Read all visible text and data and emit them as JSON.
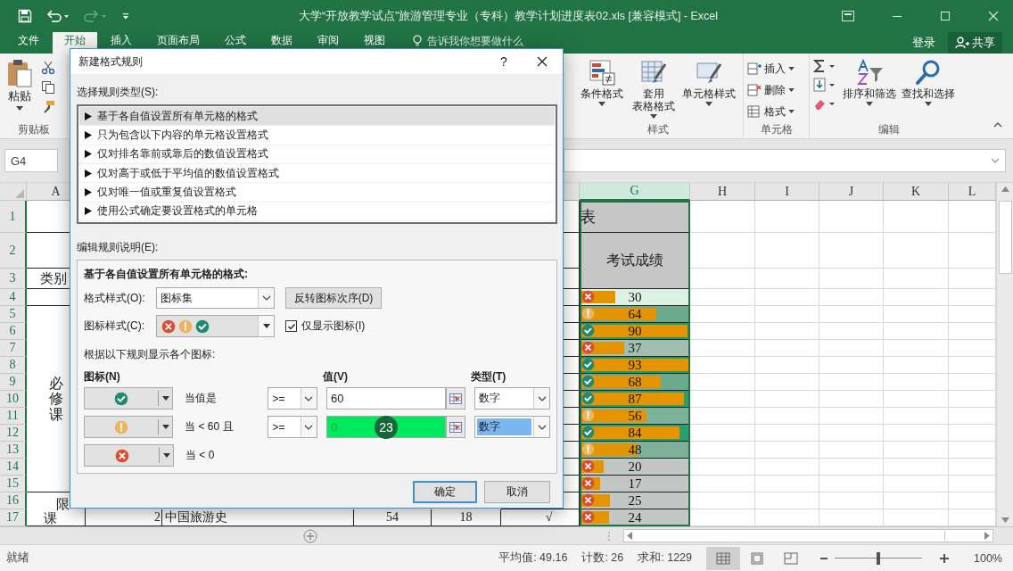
{
  "title_bar": {
    "title": "大学“开放教学试点”旅游管理专业（专科）教学计划进度表02.xls  [兼容模式] - Excel"
  },
  "ribbon_tabs": [
    {
      "label": "文件",
      "selected": false
    },
    {
      "label": "开始",
      "selected": true
    },
    {
      "label": "插入",
      "selected": false
    },
    {
      "label": "页面布局",
      "selected": false
    },
    {
      "label": "公式",
      "selected": false
    },
    {
      "label": "数据",
      "selected": false
    },
    {
      "label": "审阅",
      "selected": false
    },
    {
      "label": "视图",
      "selected": false
    }
  ],
  "tell_me": {
    "placeholder": "告诉我你想要做什么"
  },
  "account": {
    "sign_in": "登录",
    "share": "共享"
  },
  "ribbon": {
    "clipboard": {
      "paste": "粘贴",
      "label": "剪贴板"
    },
    "styles": {
      "items": [
        [
          "条件格式"
        ],
        [
          "套用",
          "表格格式"
        ],
        [
          "单元格样式"
        ]
      ],
      "label": "样式"
    },
    "cells": {
      "items": [
        "插入",
        "删除",
        "格式"
      ],
      "label": "单元格"
    },
    "editing": {
      "items": [
        "排序和筛选",
        "查找和选择"
      ],
      "label": "编辑"
    }
  },
  "name_box": "G4",
  "sheet": {
    "columns": [
      {
        "label": "A",
        "selected": false
      },
      {
        "label": "G",
        "selected": true
      },
      {
        "label": "H",
        "selected": false
      },
      {
        "label": "I",
        "selected": false
      },
      {
        "label": "J",
        "selected": false
      },
      {
        "label": "K",
        "selected": false
      },
      {
        "label": "L",
        "selected": false
      }
    ],
    "row_numbers": [
      "1",
      "2",
      "3",
      "4",
      "5",
      "6",
      "7",
      "8",
      "9",
      "10",
      "11",
      "12",
      "13",
      "14",
      "15",
      "16",
      "17"
    ],
    "category_header": "类别",
    "group_1": "必修课",
    "group_2": [
      "限",
      "课"
    ],
    "title_fragment": "表",
    "score_header": "考试成绩",
    "scores": [
      {
        "value": "30",
        "kind": "cross",
        "level": 0.31,
        "color": "#ddf0e4"
      },
      {
        "value": "64",
        "kind": "warn",
        "level": 0.68,
        "color": "#6aa98c"
      },
      {
        "value": "90",
        "kind": "check",
        "level": 0.96,
        "color": "#1f9a6c"
      },
      {
        "value": "37",
        "kind": "cross",
        "level": 0.39,
        "color": "#a2beb0"
      },
      {
        "value": "93",
        "kind": "check",
        "level": 1.0,
        "color": "#1f9a6c"
      },
      {
        "value": "68",
        "kind": "check",
        "level": 0.72,
        "color": "#6aa98c"
      },
      {
        "value": "87",
        "kind": "check",
        "level": 0.93,
        "color": "#2a9e6f"
      },
      {
        "value": "56",
        "kind": "warn",
        "level": 0.59,
        "color": "#7bb298"
      },
      {
        "value": "84",
        "kind": "check",
        "level": 0.89,
        "color": "#2a9e6f"
      },
      {
        "value": "48",
        "kind": "warn",
        "level": 0.51,
        "color": "#7bb298"
      },
      {
        "value": "20",
        "kind": "cross",
        "level": 0.2,
        "color": "#c2c6c4"
      },
      {
        "value": "17",
        "kind": "cross",
        "level": 0.17,
        "color": "#c2c6c4"
      },
      {
        "value": "25",
        "kind": "cross",
        "level": 0.26,
        "color": "#c2c6c4"
      },
      {
        "value": "24",
        "kind": "cross",
        "level": 0.25,
        "color": "#c2c6c4"
      }
    ],
    "row_17": [
      "2",
      "中国旅游史",
      "54",
      "18",
      "√"
    ]
  },
  "dialog": {
    "title": "新建格式规则",
    "help": "?",
    "rule_type_label": "选择规则类型(S):",
    "rule_types": [
      {
        "label": "基于各自值设置所有单元格的格式",
        "selected": true
      },
      {
        "label": "只为包含以下内容的单元格设置格式",
        "selected": false
      },
      {
        "label": "仅对排名靠前或靠后的数值设置格式",
        "selected": false
      },
      {
        "label": "仅对高于或低于平均值的数值设置格式",
        "selected": false
      },
      {
        "label": "仅对唯一值或重复值设置格式",
        "selected": false
      },
      {
        "label": "使用公式确定要设置格式的单元格",
        "selected": false
      }
    ],
    "edit_label": "编辑规则说明(E):",
    "section_title": "基于各自值设置所有单元格的格式:",
    "format_style": {
      "label": "格式样式(O):",
      "value": "图标集"
    },
    "reverse_button": "反转图标次序(D)",
    "icon_style": {
      "label": "图标样式(C):",
      "icons": [
        {
          "kind": "cross"
        },
        {
          "kind": "warn"
        },
        {
          "kind": "check"
        }
      ]
    },
    "show_icon_only": {
      "label": "仅显示图标(I)",
      "checked": true
    },
    "rules_label": "根据以下规则显示各个图标:",
    "headers": {
      "icon": "图标(N)",
      "value": "值(V)",
      "type": "类型(T)"
    },
    "rules": [
      {
        "kind": "check",
        "condition": "当值是",
        "operator": ">=",
        "value": "60",
        "type": "数字",
        "highlighted": false,
        "selected": false
      },
      {
        "kind": "warn",
        "condition": "当 < 60 且",
        "operator": ">=",
        "value": "0",
        "type": "数字",
        "highlighted": true,
        "selected": true,
        "step_marker": "23"
      },
      {
        "kind": "cross",
        "condition": "当 < 0"
      }
    ],
    "buttons": [
      {
        "label": "确定",
        "default": true
      },
      {
        "label": "取消",
        "default": false
      }
    ]
  },
  "status_bar": {
    "status": "就绪",
    "stats": [
      "平均值: 49.16",
      "计数: 26",
      "求和: 1229"
    ],
    "views": [
      {
        "kind": "normal",
        "selected": true
      },
      {
        "kind": "page_layout",
        "selected": false
      },
      {
        "kind": "page_break",
        "selected": false
      }
    ],
    "zoom": {
      "level": 0.5,
      "percent": "100%"
    }
  }
}
